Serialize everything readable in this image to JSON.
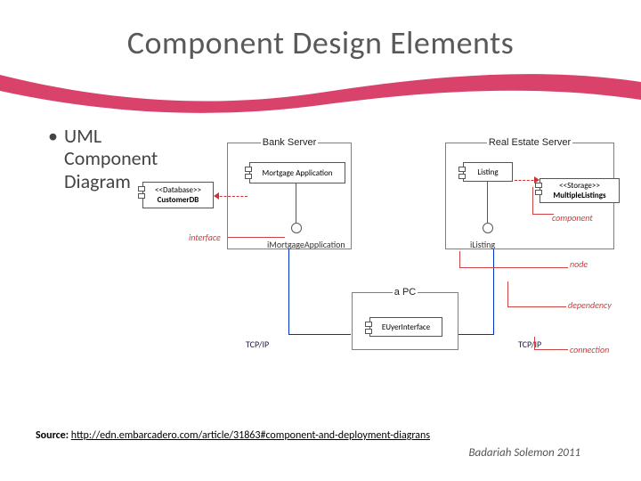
{
  "title": "Component Design Elements",
  "bullet": {
    "l1": "UML",
    "l2": "Component",
    "l3": "Diagram"
  },
  "diagram": {
    "bank_server": "Bank Server",
    "real_estate": "Real Estate Server",
    "apc": "a PC",
    "customer_db_stereo": "<<Database>>",
    "customer_db": "CustomerDB",
    "mortgage_app": "Mortgage Application",
    "listing": "Listing",
    "multiple_listings_stereo": "<<Storage>>",
    "multiple_listings": "MultipleListings",
    "euyer": "EUyerInterface",
    "iface_mortgage": "iMortgageApplication",
    "iface_listing": "iListing",
    "tcpip": "TCP/IP",
    "annotations": {
      "interface": "interface",
      "component": "component",
      "node": "node",
      "dependency": "dependency",
      "connection": "connection"
    }
  },
  "source": {
    "label": "Source:",
    "url": "http://edn.embarcadero.com/article/31863#component-and-deployment-diagrans"
  },
  "credit": "Badariah Solemon 2011"
}
